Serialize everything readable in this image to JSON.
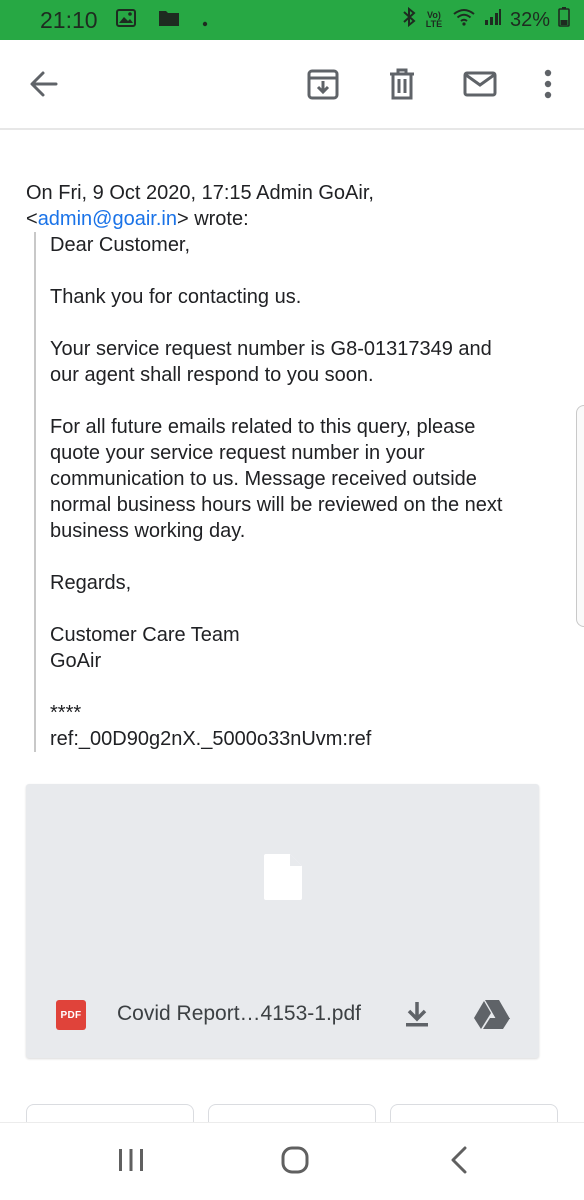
{
  "status_bar": {
    "time": "21:10",
    "network_label": "Vo) LTE",
    "battery": "32%",
    "left_icons": [
      "image-icon",
      "folder-icon",
      "dot-icon"
    ],
    "right_icons": [
      "bluetooth-icon",
      "volte-icon",
      "wifi-icon",
      "signal-icon",
      "battery-icon"
    ],
    "bg_color": "#27a844"
  },
  "app_bar": {
    "actions": [
      "back-icon",
      "archive-icon",
      "delete-icon",
      "mail-icon",
      "more-icon"
    ]
  },
  "message": {
    "quote_header_prefix": "On Fri, 9 Oct 2020, 17:15 Admin GoAir,",
    "quote_header_lt": "<",
    "sender_email": "admin@goair.in",
    "quote_header_suffix": "> wrote:",
    "body": {
      "greeting": "Dear Customer,",
      "thanks": "Thank you for contacting us.",
      "request_line1": "Your service request number is G8-01317349 and",
      "request_line2": "our agent shall respond to you soon.",
      "future_line1": "For all future emails related to this query, please",
      "future_line2": "quote your service request number in your",
      "future_line3": "communication to us. Message received outside",
      "future_line4": "normal business hours will be reviewed on the next",
      "future_line5": "business working day.",
      "regards": "Regards,",
      "team": "Customer Care Team",
      "company": "GoAir",
      "stars": "****",
      "ref": "ref:_00D90g2nX._5000o33nUvm:ref"
    },
    "link_color": "#1a73e8"
  },
  "attachment": {
    "type_badge": "PDF",
    "filename": "Covid Report…4153-1.pdf",
    "badge_color": "#e0433a",
    "icons": [
      "file-icon",
      "download-icon",
      "drive-icon"
    ]
  },
  "nav_bar": {
    "buttons": [
      "recents-icon",
      "home-icon",
      "back-nav-icon"
    ]
  }
}
